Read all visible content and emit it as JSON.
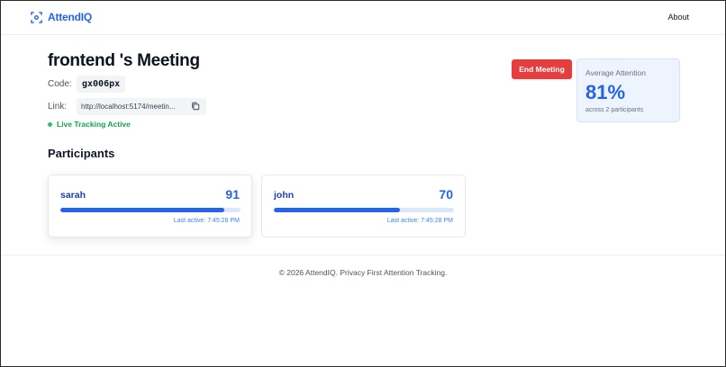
{
  "nav": {
    "brand": "AttendIQ",
    "about": "About"
  },
  "meeting": {
    "title": "frontend 's Meeting",
    "code_label": "Code:",
    "code": "gx006px",
    "link_label": "Link:",
    "link": "http://localhost:5174/meetin...",
    "live_status": "Live Tracking Active",
    "end_button": "End Meeting"
  },
  "average": {
    "label": "Average Attention",
    "value": "81%",
    "sub": "across 2 participants"
  },
  "participants": {
    "heading": "Participants",
    "items": [
      {
        "name": "sarah",
        "score": "91",
        "progress": 0.91,
        "last_active": "Last active: 7:45:28 PM"
      },
      {
        "name": "john",
        "score": "70",
        "progress": 0.7,
        "last_active": "Last active: 7:45:28 PM"
      }
    ]
  },
  "footer": {
    "text": "© 2026 AttendIQ. Privacy First Attention Tracking."
  },
  "colors": {
    "accent": "#2563eb",
    "danger": "#e53e3e",
    "live": "#16a34a"
  }
}
